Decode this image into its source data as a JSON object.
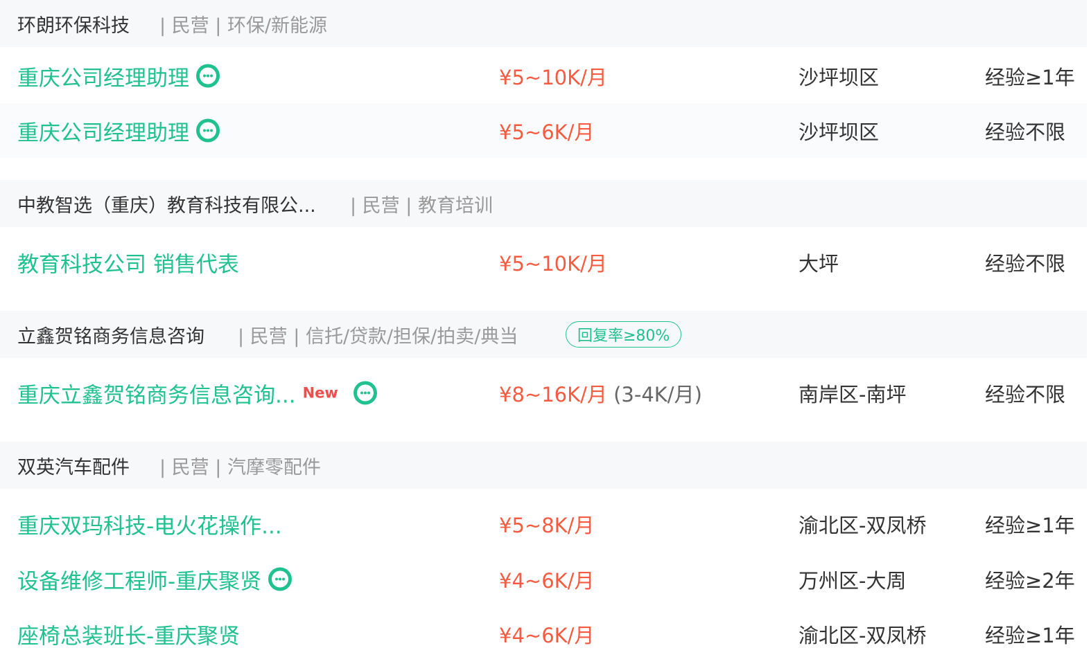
{
  "companies": [
    {
      "name": "环朗环保科技",
      "meta": "| 民营 | 环保/新能源",
      "jobs": [
        {
          "title": "重庆公司经理助理",
          "salary": "¥5~10K/月",
          "location": "沙坪坝区",
          "experience": "经验≥1年",
          "chat_icon": "chat-icon"
        },
        {
          "title": "重庆公司经理助理",
          "salary": "¥5~6K/月",
          "location": "沙坪坝区",
          "experience": "经验不限",
          "chat_icon": "chat-icon"
        }
      ]
    },
    {
      "name": "中教智选（重庆）教育科技有限公...",
      "meta": "| 民营 | 教育培训",
      "jobs": [
        {
          "title": "教育科技公司 销售代表",
          "salary": "¥5~10K/月",
          "location": "大坪",
          "experience": "经验不限"
        }
      ]
    },
    {
      "name": "立鑫贺铭商务信息咨询",
      "meta": "| 民营 | 信托/贷款/担保/拍卖/典当",
      "badge": "回复率≥80%",
      "jobs": [
        {
          "title": "重庆立鑫贺铭商务信息咨询...",
          "new_label": "New",
          "salary": "¥8~16K/月",
          "salary_sub": "(3-4K/月)",
          "location": "南岸区-南坪",
          "experience": "经验不限",
          "chat_icon": "chat-icon"
        }
      ]
    },
    {
      "name": "双英汽车配件",
      "meta": "| 民营 | 汽摩零配件",
      "jobs": [
        {
          "title": "重庆双玛科技-电火花操作...",
          "salary": "¥5~8K/月",
          "location": "渝北区-双凤桥",
          "experience": "经验≥1年"
        },
        {
          "title": "设备维修工程师-重庆聚贤",
          "salary": "¥4~6K/月",
          "location": "万州区-大周",
          "experience": "经验≥2年",
          "chat_icon": "chat-icon"
        },
        {
          "title": "座椅总装班长-重庆聚贤",
          "salary": "¥4~6K/月",
          "location": "渝北区-双凤桥",
          "experience": "经验≥1年"
        }
      ]
    }
  ],
  "colors": {
    "accent": "#1fc28e",
    "salary": "#f75a3f",
    "new": "#f04d4d",
    "header_bg": "#f7f8fa"
  }
}
